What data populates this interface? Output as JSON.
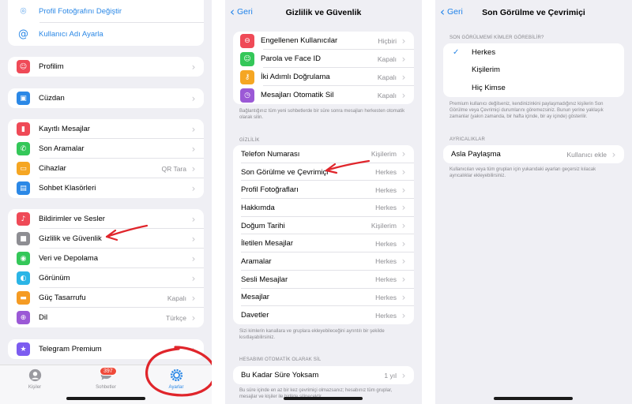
{
  "settings": {
    "top_links": [
      "Profil Fotoğrafını Değiştir",
      "Kullanıcı Adı Ayarla"
    ],
    "groups": [
      [
        {
          "label": "Profilim",
          "icon": "person-icon",
          "color": "#ef4a57"
        }
      ],
      [
        {
          "label": "Cüzdan",
          "icon": "wallet-icon",
          "color": "#2b88e6"
        }
      ],
      [
        {
          "label": "Kayıtlı Mesajlar",
          "icon": "bookmark-icon",
          "color": "#ef4a57"
        },
        {
          "label": "Son Aramalar",
          "icon": "phone-icon",
          "color": "#34c759"
        },
        {
          "label": "Cihazlar",
          "value": "QR Tara",
          "icon": "devices-icon",
          "color": "#f5a623"
        },
        {
          "label": "Sohbet Klasörleri",
          "icon": "folder-icon",
          "color": "#2b88e6"
        }
      ],
      [
        {
          "label": "Bildirimler ve Sesler",
          "icon": "bell-icon",
          "color": "#ef4a57"
        },
        {
          "label": "Gizlilik ve Güvenlik",
          "icon": "lock-icon",
          "color": "#8e8e93"
        },
        {
          "label": "Veri ve Depolama",
          "icon": "data-icon",
          "color": "#34c759"
        },
        {
          "label": "Görünüm",
          "icon": "appearance-icon",
          "color": "#2bb5e6"
        },
        {
          "label": "Güç Tasarrufu",
          "value": "Kapalı",
          "icon": "battery-icon",
          "color": "#f59b23"
        },
        {
          "label": "Dil",
          "value": "Türkçe",
          "icon": "globe-icon",
          "color": "#9b59d6"
        }
      ],
      [
        {
          "label": "Telegram Premium",
          "icon": "star-icon",
          "color": "#7c5cf0"
        }
      ]
    ],
    "tabs": [
      {
        "label": "Kişiler",
        "icon": "contacts-icon"
      },
      {
        "label": "Sohbetler",
        "icon": "chats-icon",
        "badge": "397"
      },
      {
        "label": "Ayarlar",
        "icon": "settings-icon",
        "active": true
      }
    ]
  },
  "privacy": {
    "back": "Geri",
    "title": "Gizlilik ve Güvenlik",
    "security": [
      {
        "label": "Engellenen Kullanıcılar",
        "value": "Hiçbiri",
        "icon": "block-icon",
        "color": "#ef4a57"
      },
      {
        "label": "Parola ve Face ID",
        "value": "Kapalı",
        "icon": "faceid-icon",
        "color": "#34c759"
      },
      {
        "label": "İki Adımlı Doğrulama",
        "value": "Kapalı",
        "icon": "key-icon",
        "color": "#f5a623"
      },
      {
        "label": "Mesajları Otomatik Sil",
        "value": "Kapalı",
        "icon": "timer-icon",
        "color": "#9b59d6"
      }
    ],
    "security_note": "Bağlantığınız tüm yeni sohbetlerde bir süre sonra mesajları herkesten otomatik olarak silin.",
    "privacy_header": "GİZLİLİK",
    "privacy_items": [
      {
        "label": "Telefon Numarası",
        "value": "Kişilerim"
      },
      {
        "label": "Son Görülme ve Çevrimiçi",
        "value": "Herkes"
      },
      {
        "label": "Profil Fotoğrafları",
        "value": "Herkes"
      },
      {
        "label": "Hakkımda",
        "value": "Herkes"
      },
      {
        "label": "Doğum Tarihi",
        "value": "Kişilerim"
      },
      {
        "label": "İletilen Mesajlar",
        "value": "Herkes"
      },
      {
        "label": "Aramalar",
        "value": "Herkes"
      },
      {
        "label": "Sesli Mesajlar",
        "value": "Herkes"
      },
      {
        "label": "Mesajlar",
        "value": "Herkes"
      },
      {
        "label": "Davetler",
        "value": "Herkes"
      }
    ],
    "privacy_note": "Sizi kimlerin kanallara ve gruplara ekleyebileceğini ayrıntılı bir şekilde kısıtlayabilirsiniz.",
    "delete_header": "HESABIMI OTOMATİK OLARAK SİL",
    "delete_item": {
      "label": "Bu Kadar Süre Yoksam",
      "value": "1 yıl"
    },
    "delete_note": "Bu süre içinde en az bir kez çevrimiçi olmazsanız; hesabınız tüm gruplar, mesajlar ve kişiler ile birlikte silinecektir."
  },
  "lastseen": {
    "back": "Geri",
    "title": "Son Görülme ve Çevrimiçi",
    "header": "SON GÖRÜLMEMİ KİMLER GÖREBİLİR?",
    "options": [
      {
        "label": "Herkes",
        "checked": true
      },
      {
        "label": "Kişilerim"
      },
      {
        "label": "Hiç Kimse"
      }
    ],
    "note": "Premium kullanıcı değilseniz, kendinizinkini paylaşmadığınız kişilerin Son Görülme veya Çevrimiçi durumlarını göremezsiniz. Bunun yerine yaklaşık zamanlar (yakın zamanda, bir hafta içinde, bir ay içinde) gösterilir.",
    "exceptions_header": "AYRICALIKLAR",
    "exception": {
      "label": "Asla Paylaşma",
      "value": "Kullanıcı ekle"
    },
    "exception_note": "Kullanıcıları veya tüm grupları için yukarıdaki ayarları geçersiz kılacak ayrıcalıklar ekleyebilirsiniz."
  },
  "colors": {
    "accent": "#2b88e6",
    "annotation": "#e0252b",
    "badge": "#ef4a3a"
  }
}
